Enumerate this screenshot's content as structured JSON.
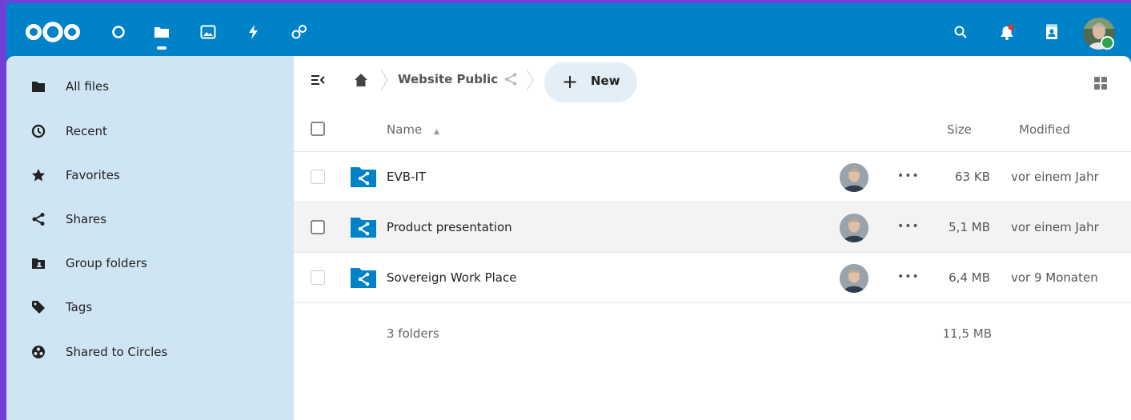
{
  "colors": {
    "primary": "#0082c9",
    "sidebar_bg": "#cfe5f4",
    "frame_purple": "#6f3fd6",
    "status_online": "#2ea44f",
    "notification_dot": "#e9322d"
  },
  "header": {
    "logo_icon": "nextcloud-logo",
    "apps": [
      {
        "icon": "dashboard-circle-icon"
      },
      {
        "icon": "files-folder-icon"
      },
      {
        "icon": "photos-icon"
      },
      {
        "icon": "activity-bolt-icon"
      },
      {
        "icon": "circles-icon"
      }
    ],
    "right_icons": [
      "search-icon",
      "notifications-bell-icon",
      "contacts-icon"
    ]
  },
  "sidebar": {
    "items": [
      {
        "label": "All files",
        "icon": "folder-icon"
      },
      {
        "label": "Recent",
        "icon": "clock-icon"
      },
      {
        "label": "Favorites",
        "icon": "star-icon"
      },
      {
        "label": "Shares",
        "icon": "share-icon"
      },
      {
        "label": "Group folders",
        "icon": "group-folder-icon"
      },
      {
        "label": "Tags",
        "icon": "tag-icon"
      },
      {
        "label": "Shared to Circles",
        "icon": "circles-icon"
      }
    ]
  },
  "breadcrumb": {
    "current": "Website Public"
  },
  "new_button": {
    "plus": "+",
    "label": "New"
  },
  "table": {
    "headers": {
      "name": "Name",
      "size": "Size",
      "modified": "Modified"
    },
    "rows": [
      {
        "name": "EVB-IT",
        "size": "63 KB",
        "modified": "vor einem Jahr"
      },
      {
        "name": "Product presentation",
        "size": "5,1 MB",
        "modified": "vor einem Jahr"
      },
      {
        "name": "Sovereign Work Place",
        "size": "6,4 MB",
        "modified": "vor 9 Monaten"
      }
    ],
    "row_menu": "•••",
    "summary": {
      "count": "3 folders",
      "size": "11,5 MB"
    }
  }
}
